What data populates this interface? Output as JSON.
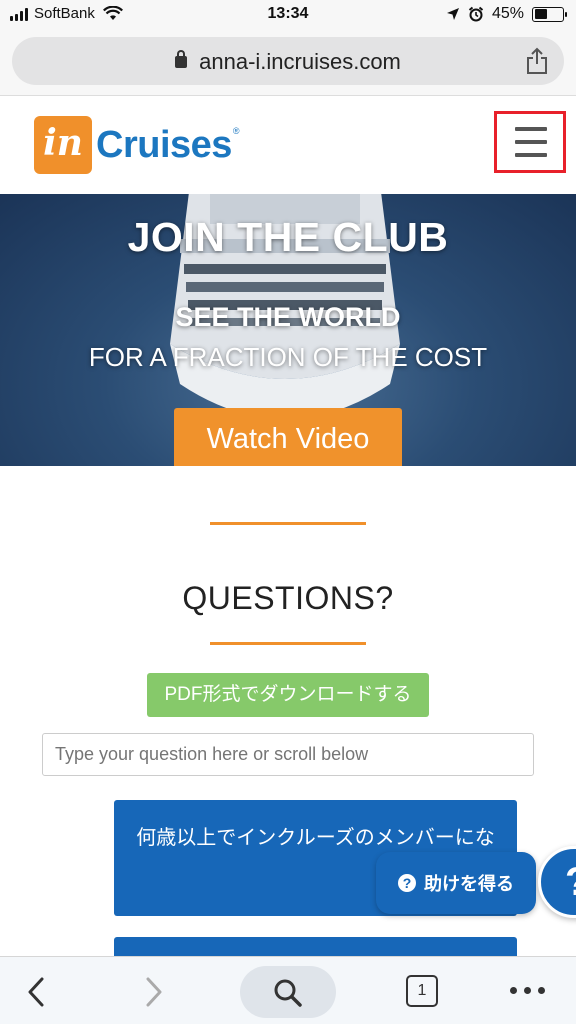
{
  "status_bar": {
    "carrier": "SoftBank",
    "time": "13:34",
    "battery": "45%",
    "battery_level": 0.45
  },
  "browser": {
    "url": "anna-i.incruises.com",
    "tab_count": "1"
  },
  "header": {
    "logo_in": "in",
    "logo_text": "Cruises",
    "logo_reg": "®"
  },
  "hero": {
    "title": "JOIN THE CLUB",
    "subtitle1": "SEE THE WORLD",
    "subtitle2": "FOR A FRACTION OF THE COST",
    "watch_video": "Watch Video"
  },
  "content": {
    "questions_heading": "QUESTIONS?",
    "pdf_button": "PDF形式でダウンロードする",
    "search_placeholder": "Type your question here or scroll below",
    "faq_items": [
      {
        "label": "何歳以上でインクルーズのメンバーにな"
      },
      {
        "label": ""
      }
    ]
  },
  "help": {
    "label": "助けを得る",
    "question_mark": "?"
  },
  "colors": {
    "brand_orange": "#f0902b",
    "brand_blue": "#1767b8",
    "pdf_green": "#86c96a",
    "highlight_red": "#e8202a"
  },
  "icons": [
    "lock-icon",
    "share-icon",
    "hamburger-menu-icon",
    "help-icon",
    "back-icon",
    "forward-icon",
    "search-icon",
    "tabs-icon",
    "more-icon"
  ]
}
